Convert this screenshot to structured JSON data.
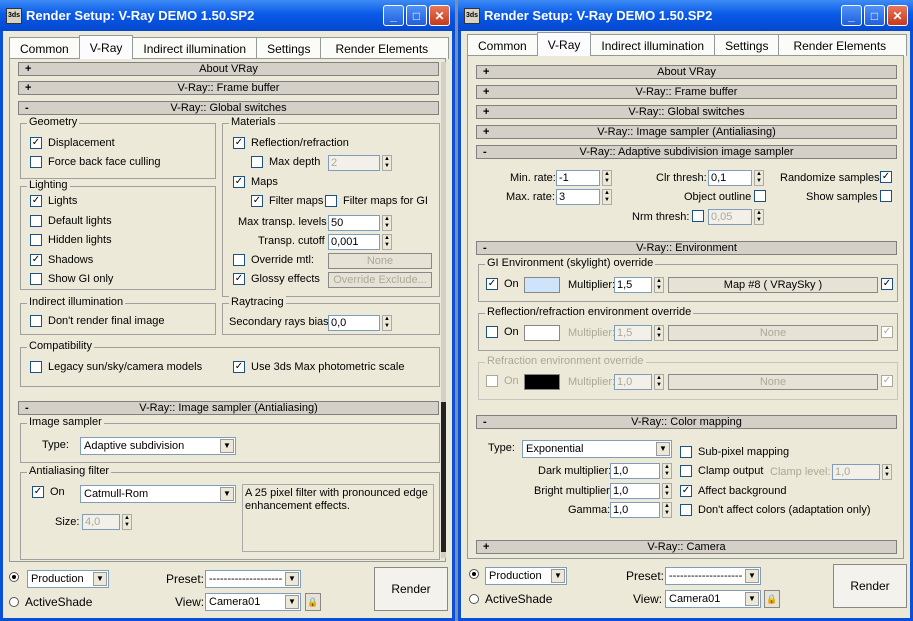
{
  "left": {
    "title": "Render Setup: V-Ray DEMO 1.50.SP2",
    "tabs": [
      "Common",
      "V-Ray",
      "Indirect illumination",
      "Settings",
      "Render Elements"
    ],
    "rollouts": {
      "about": "About VRay",
      "fb": "V-Ray:: Frame buffer",
      "gs": "V-Ray:: Global switches",
      "is": "V-Ray:: Image sampler (Antialiasing)"
    },
    "geometry": {
      "label": "Geometry",
      "displacement": "Displacement",
      "force": "Force back face culling"
    },
    "lighting": {
      "label": "Lighting",
      "lights": "Lights",
      "default": "Default lights",
      "hidden": "Hidden lights",
      "shadows": "Shadows",
      "show_gi": "Show GI only"
    },
    "materials": {
      "label": "Materials",
      "refl": "Reflection/refraction",
      "maxdepth": "Max depth",
      "maxdepth_val": "2",
      "maps": "Maps",
      "filter": "Filter maps",
      "filter_gi": "Filter maps for GI",
      "transp_levels": "Max transp. levels",
      "transp_levels_val": "50",
      "transp_cutoff": "Transp. cutoff",
      "transp_cutoff_val": "0,001",
      "override": "Override mtl:",
      "override_btn": "None",
      "glossy": "Glossy effects",
      "override_excl": "Override Exclude..."
    },
    "indirect": {
      "label": "Indirect illumination",
      "dont_render": "Don't render final image"
    },
    "raytracing": {
      "label": "Raytracing",
      "bias": "Secondary rays bias",
      "bias_val": "0,0"
    },
    "compat": {
      "label": "Compatibility",
      "legacy": "Legacy sun/sky/camera models",
      "photometric": "Use 3ds Max photometric scale"
    },
    "sampler": {
      "label": "Image sampler",
      "type_label": "Type:",
      "type": "Adaptive subdivision"
    },
    "aa": {
      "label": "Antialiasing filter",
      "on": "On",
      "filter": "Catmull-Rom",
      "desc": "A 25 pixel filter with pronounced edge enhancement effects.",
      "size": "Size:",
      "size_val": "4,0"
    },
    "bottom": {
      "production": "Production",
      "activeshade": "ActiveShade",
      "preset": "Preset:",
      "preset_val": "--------------------",
      "view": "View:",
      "view_val": "Camera01",
      "render": "Render"
    }
  },
  "right": {
    "title": "Render Setup: V-Ray DEMO 1.50.SP2",
    "tabs": [
      "Common",
      "V-Ray",
      "Indirect illumination",
      "Settings",
      "Render Elements"
    ],
    "rollouts": {
      "about": "About VRay",
      "fb": "V-Ray:: Frame buffer",
      "gs": "V-Ray:: Global switches",
      "is": "V-Ray:: Image sampler (Antialiasing)",
      "adaptive": "V-Ray:: Adaptive subdivision image sampler",
      "env": "V-Ray:: Environment",
      "cm": "V-Ray:: Color mapping",
      "cam": "V-Ray:: Camera"
    },
    "adaptive": {
      "min": "Min. rate:",
      "min_val": "-1",
      "max": "Max. rate:",
      "max_val": "3",
      "clr": "Clr thresh:",
      "clr_val": "0,1",
      "outline": "Object outline",
      "nrm": "Nrm thresh:",
      "nrm_val": "0,05",
      "randomize": "Randomize samples",
      "show": "Show samples"
    },
    "gi_env": {
      "label": "GI Environment (skylight) override",
      "on": "On",
      "mult": "Multiplier:",
      "mult_val": "1,5",
      "map": "Map #8  ( VRaySky )",
      "color": "#cfe4fb"
    },
    "refl_env": {
      "label": "Reflection/refraction environment override",
      "on": "On",
      "mult": "Multiplier:",
      "mult_val": "1,5",
      "map": "None",
      "color": "#ffffff"
    },
    "refr_env": {
      "label": "Refraction environment override",
      "on": "On",
      "mult": "Multiplier:",
      "mult_val": "1,0",
      "map": "None",
      "color": "#000000"
    },
    "cm": {
      "type_label": "Type:",
      "type": "Exponential",
      "dark": "Dark multiplier:",
      "dark_val": "1,0",
      "bright": "Bright multiplier:",
      "bright_val": "1,0",
      "gamma": "Gamma:",
      "gamma_val": "1,0",
      "subpixel": "Sub-pixel mapping",
      "clamp": "Clamp output",
      "clamp_level": "Clamp level:",
      "clamp_level_val": "1,0",
      "affect_bg": "Affect background",
      "dont_affect": "Don't affect colors (adaptation only)"
    },
    "bottom": {
      "production": "Production",
      "activeshade": "ActiveShade",
      "preset": "Preset:",
      "preset_val": "--------------------",
      "view": "View:",
      "view_val": "Camera01",
      "render": "Render"
    }
  },
  "title_icon": "3ds",
  "checkmark": "✓",
  "plus": "+",
  "minus": "-",
  "btn_min": "_",
  "btn_max": "□",
  "btn_close": "✕",
  "spin_up": "▲",
  "spin_down": "▼",
  "dd_arrow": "▼",
  "lock": "🔒"
}
